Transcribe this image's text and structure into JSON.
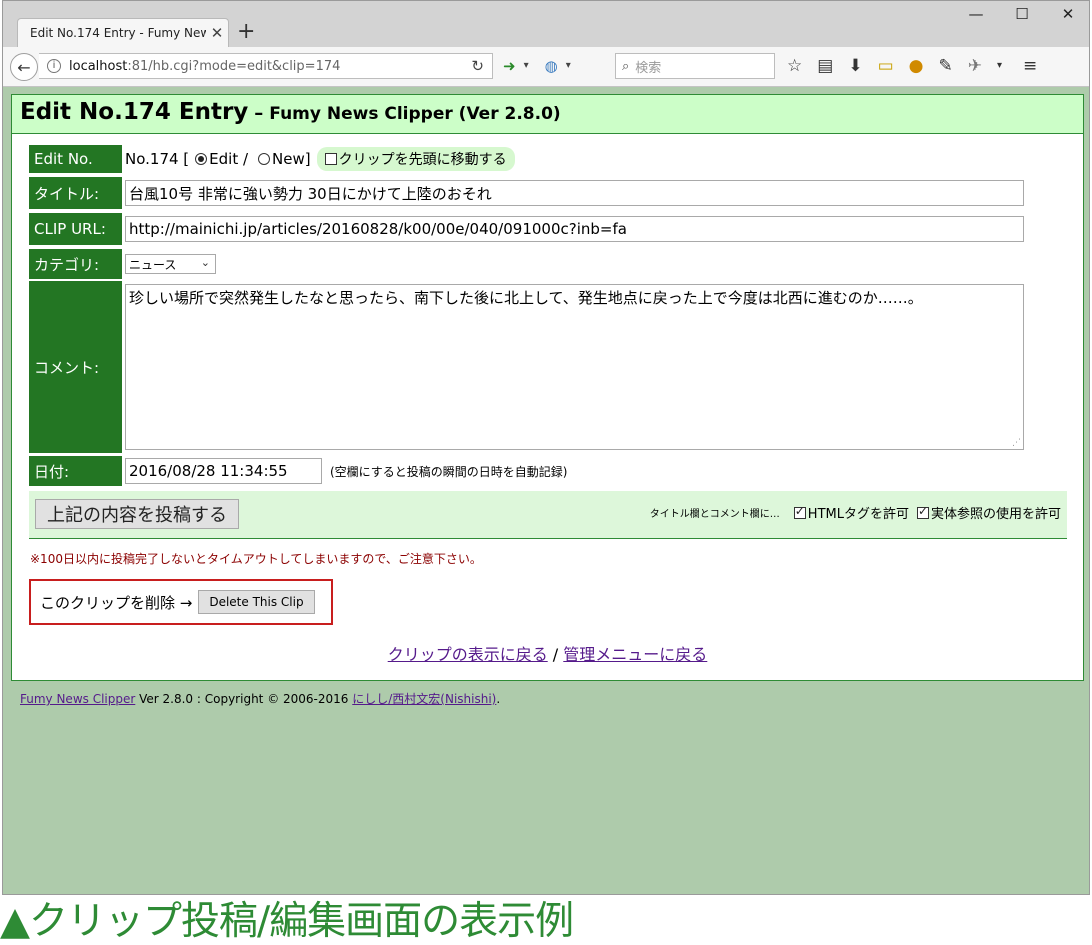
{
  "browser": {
    "tab_title": "Edit No.174 Entry - Fumy New...",
    "tab_close": "✕",
    "new_tab": "+",
    "window_controls": [
      "—",
      "☐",
      "✕"
    ],
    "url_host": "localhost",
    "url_rest": ":81/hb.cgi?mode=edit&clip=174",
    "search_placeholder": "検索",
    "icons": [
      "back-icon",
      "info-icon",
      "reload-icon",
      "arrow-icon",
      "globe-icon",
      "search-icon",
      "star-icon",
      "reader-icon",
      "download-icon",
      "folder-icon",
      "extension-icon",
      "wrench-icon",
      "addon-icon",
      "menu-icon"
    ]
  },
  "header": {
    "title": "Edit No.174 Entry",
    "dash": "–",
    "subtitle": "Fumy News Clipper (Ver 2.8.0)"
  },
  "form": {
    "edit_no_label": "Edit No.",
    "edit_no_value": "No.174 [",
    "radio_edit": "Edit /",
    "radio_new": "New]",
    "move_top_label": "クリップを先頭に移動する",
    "title_label": "タイトル:",
    "title_value": "台風10号 非常に強い勢力 30日にかけて上陸のおそれ",
    "url_label": "CLIP URL:",
    "url_value": "http://mainichi.jp/articles/20160828/k00/00e/040/091000c?inb=fa",
    "category_label": "カテゴリ:",
    "category_value": "ニュース",
    "comment_label": "コメント:",
    "comment_value": "珍しい場所で突然発生したなと思ったら、南下した後に北上して、発生地点に戻った上で今度は北西に進むのか……。",
    "date_label": "日付:",
    "date_value": "2016/08/28 11:34:55",
    "date_hint": "(空欄にすると投稿の瞬間の日時を自動記録)"
  },
  "submit": {
    "button_label": "上記の内容を投稿する",
    "options_prefix": "タイトル欄とコメント欄に…",
    "allow_html": "HTMLタグを許可",
    "allow_entity": "実体参照の使用を許可"
  },
  "timeout_note": "※100日以内に投稿完了しないとタイムアウトしてしまいますので、ご注意下さい。",
  "delete": {
    "label": "このクリップを削除 →",
    "button_label": "Delete This Clip"
  },
  "links": {
    "back_to_clip": "クリップの表示に戻る",
    "separator": "/",
    "back_to_menu": "管理メニューに戻る"
  },
  "footer": {
    "link_app": "Fumy News Clipper",
    "version_text": "Ver 2.8.0 : Copyright © 2006-2016",
    "link_author": "にしし/西村文宏(Nishishi)",
    "end": "."
  },
  "caption": "▲クリップ投稿/編集画面の表示例",
  "colors": {
    "label_bg": "#237623",
    "header_bg": "#ccfec8",
    "page_bg": "#aecbab",
    "caption": "#2e8b35",
    "delete_border": "#c81e1e"
  }
}
